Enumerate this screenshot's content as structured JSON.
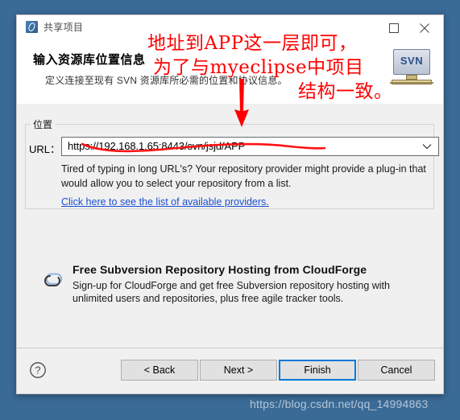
{
  "window": {
    "title": "共享项目",
    "app_icon": "svn-share-icon",
    "maximize_label": "maximize-icon",
    "close_label": "close-icon"
  },
  "header": {
    "heading": "输入资源库位置信息",
    "subheading": "定义连接至现有 SVN 资源库所必需的位置和协议信息。",
    "badge_text": "SVN"
  },
  "location_group": {
    "legend": "位置",
    "url_label": "URL：",
    "url_value": "https://192.168.1.65:8443/svn/jsjd/APP",
    "url_placeholder": "https://",
    "help_text": "Tired of typing in long URL's?  Your repository provider might provide a plug-in that would allow you to select your repository from a list.",
    "provider_link": "Click here to see the list of available providers."
  },
  "promo": {
    "icon": "cloud-icon",
    "title": "Free Subversion Repository Hosting from CloudForge",
    "body": "Sign-up for CloudForge and get free Subversion repository hosting with unlimited users and repositories, plus free agile tracker tools."
  },
  "footer": {
    "help_icon": "help-question-icon",
    "buttons": [
      {
        "label": "< Back",
        "name": "back-button",
        "default": false
      },
      {
        "label": "Next >",
        "name": "next-button",
        "default": false
      },
      {
        "label": "Finish",
        "name": "finish-button",
        "default": true
      },
      {
        "label": "Cancel",
        "name": "cancel-button",
        "default": false
      }
    ]
  },
  "annotations": {
    "line1": "地址到APP这一层即可，",
    "line2": "为了与myeclipse中项目",
    "line3": "结构一致。",
    "arrow": "red-down-arrow",
    "underline": "red-wavy-underline",
    "color": "#ff0000"
  },
  "watermark": {
    "text": "https://blog.csdn.net/qq_14994863"
  }
}
